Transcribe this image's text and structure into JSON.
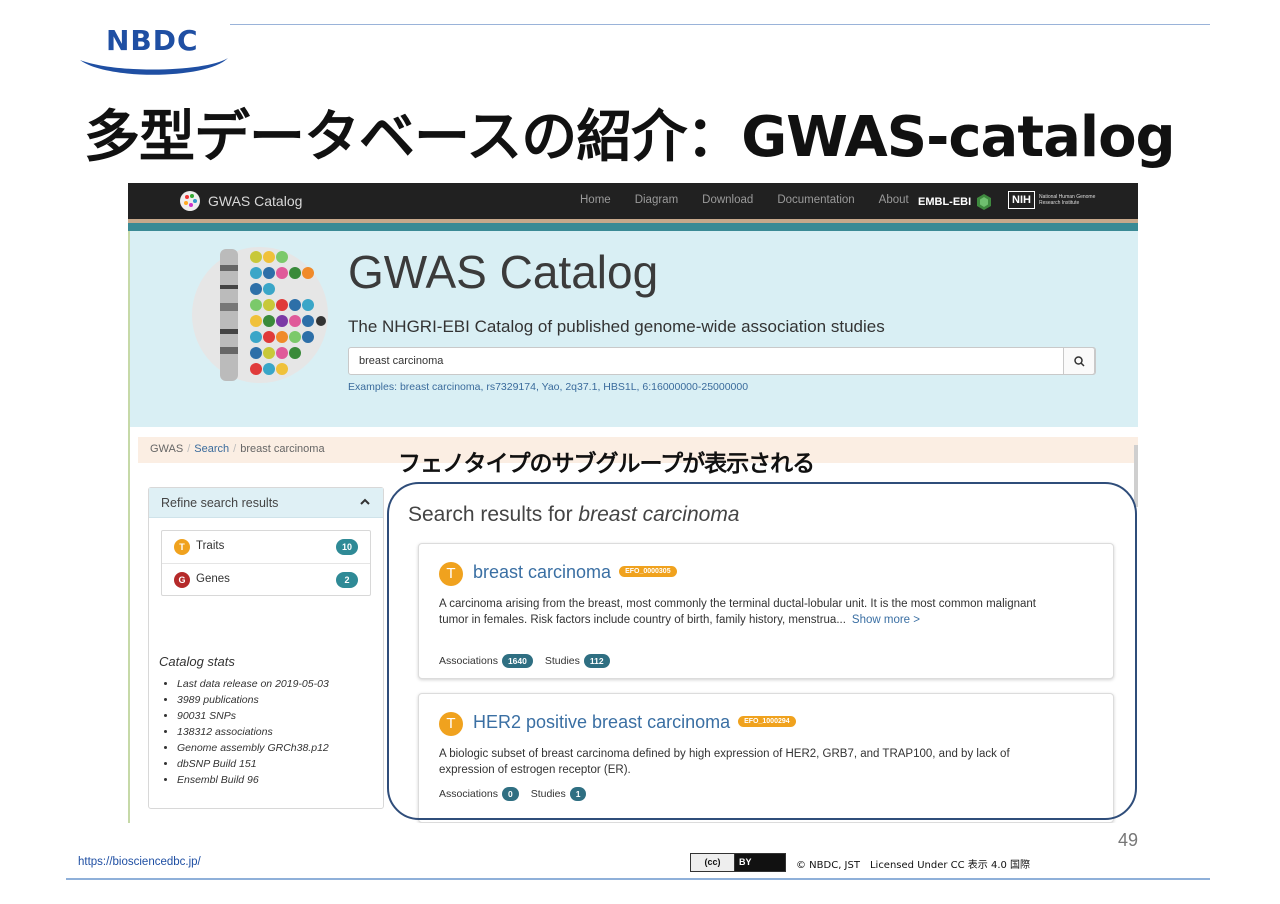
{
  "slide": {
    "logo_text": "NBDC",
    "title": "多型データベースの紹介：GWAS-catalog",
    "annotation": "フェノタイプのサブグループが表示される",
    "footer_url": "https://biosciencedbc.jp/",
    "cc_left": "(cc)",
    "cc_right": "BY",
    "license": "© NBDC, JST　Licensed Under CC 表示 4.0 国際",
    "page_number": "49"
  },
  "navbar": {
    "brand": "GWAS Catalog",
    "links": [
      "Home",
      "Diagram",
      "Download",
      "Documentation",
      "About"
    ],
    "embl": "EMBL-EBI",
    "nih": "NIH",
    "nih_sub": "National Human Genome Research Institute"
  },
  "hero": {
    "title": "GWAS Catalog",
    "subtitle": "The NHGRI-EBI Catalog of published genome-wide association studies",
    "search_value": "breast carcinoma",
    "examples_label": "Examples:",
    "examples": "breast carcinoma, rs7329174, Yao, 2q37.1, HBS1L, 6:16000000-25000000"
  },
  "breadcrumb": {
    "items": [
      "GWAS",
      "Search",
      "breast carcinoma"
    ]
  },
  "refine": {
    "title": "Refine search results",
    "items": [
      {
        "icon": "T",
        "label": "Traits",
        "count": "10",
        "color": "#f0a21e"
      },
      {
        "icon": "G",
        "label": "Genes",
        "count": "2",
        "color": "#b52a2a"
      }
    ],
    "stats_title": "Catalog stats",
    "stats": [
      "Last data release on 2019-05-03",
      "3989 publications",
      "90031 SNPs",
      "138312 associations",
      "Genome assembly GRCh38.p12",
      "dbSNP Build 151",
      "Ensembl Build 96"
    ]
  },
  "results": {
    "heading_prefix": "Search results for",
    "heading_query": "breast carcinoma",
    "cards": [
      {
        "badge": "T",
        "title": "breast carcinoma",
        "efo": "EFO_0000305",
        "description": "A carcinoma arising from the breast, most commonly the terminal ductal-lobular unit. It is the most common malignant tumor in females. Risk factors include country of birth, family history, menstrua...",
        "show_more": "Show more >",
        "associations_label": "Associations",
        "associations": "1640",
        "studies_label": "Studies",
        "studies": "112"
      },
      {
        "badge": "T",
        "title": "HER2 positive breast carcinoma",
        "efo": "EFO_1000294",
        "description": "A biologic subset of breast carcinoma defined by high expression of HER2, GRB7, and TRAP100, and by lack of expression of estrogen receptor (ER).",
        "associations_label": "Associations",
        "associations": "0",
        "studies_label": "Studies",
        "studies": "1"
      }
    ]
  }
}
